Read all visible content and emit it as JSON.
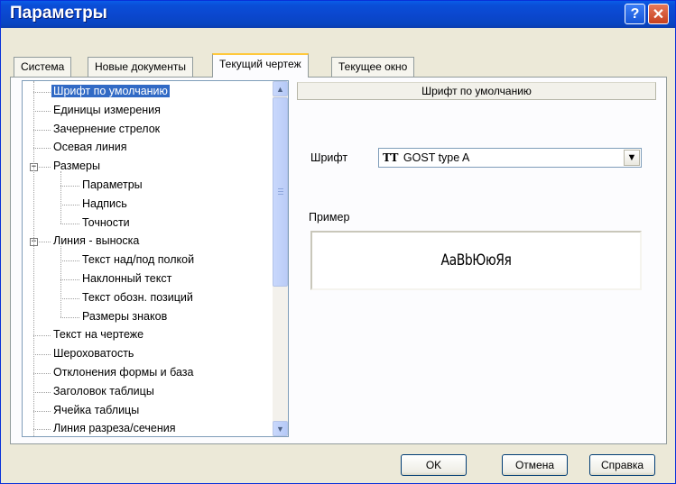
{
  "window": {
    "title": "Параметры"
  },
  "titlebar": {
    "help_label": "?",
    "close_label": "✕"
  },
  "tabs": [
    {
      "label": "Система"
    },
    {
      "label": "Новые документы"
    },
    {
      "label": "Текущий чертеж",
      "active": true
    },
    {
      "label": "Текущее окно"
    }
  ],
  "tree": {
    "items": [
      {
        "label": "Шрифт по умолчанию",
        "selected": true
      },
      {
        "label": "Единицы измерения"
      },
      {
        "label": "Зачернение стрелок"
      },
      {
        "label": "Осевая линия"
      },
      {
        "label": "Размеры",
        "expander": "−"
      },
      {
        "label": "Параметры"
      },
      {
        "label": "Надпись"
      },
      {
        "label": "Точности"
      },
      {
        "label": "Линия - выноска",
        "expander": "−"
      },
      {
        "label": "Текст над/под полкой"
      },
      {
        "label": "Наклонный текст"
      },
      {
        "label": "Текст обозн. позиций"
      },
      {
        "label": "Размеры знаков"
      },
      {
        "label": "Текст на чертеже"
      },
      {
        "label": "Шероховатость"
      },
      {
        "label": "Отклонения формы и база"
      },
      {
        "label": "Заголовок таблицы"
      },
      {
        "label": "Ячейка таблицы"
      },
      {
        "label": "Линия разреза/сечения"
      }
    ]
  },
  "panel": {
    "section_title": "Шрифт по умолчанию",
    "font_label": "Шрифт",
    "font_icon": "TT",
    "font_value": "GOST type A",
    "sample_label": "Пример",
    "sample_text": "АаВbЮюЯя"
  },
  "buttons": {
    "ok": "OK",
    "cancel": "Отмена",
    "help": "Справка"
  },
  "colors": {
    "titlebar": "#0A4FD8",
    "selection": "#316AC5",
    "window_bg": "#ECE9D8"
  }
}
